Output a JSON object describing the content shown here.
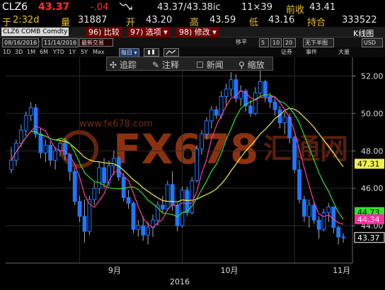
{
  "quote": {
    "ticker": "CLZ6",
    "last": "43.37",
    "change": "-.04",
    "bidask": "43.37/43.38ic",
    "size": "11×39",
    "prev_close_label": "前收",
    "prev_close": "43.41",
    "time_label": "于",
    "time": "2:32d",
    "volume_label": "量",
    "volume": "31887",
    "open_label": "开",
    "open": "43.20",
    "high_label": "高",
    "high": "43.59",
    "low_label": "低",
    "low": "43.16",
    "oi_label": "持合",
    "oi": "333522"
  },
  "ctrl": {
    "security": "CLZ6 COMB Comdty",
    "btn_compare": "96) 比较",
    "btn_options": "97) 选项 ▾",
    "btn_edit": "98) 修改 ▾",
    "chart_kind": "K线图",
    "date_from": "08/16/2016",
    "date_to": "11/14/2016",
    "period": "最新交易",
    "ma_label": "移平",
    "ma1": "5",
    "ma2": "10",
    "ma3": "20",
    "sub": "无下半图",
    "currency": "USD"
  },
  "ranges": [
    "1D",
    "3D",
    "1M",
    "6M",
    "YTD",
    "1Y",
    "5Y",
    "Max"
  ],
  "freq": "每日 ▾",
  "right_tools": [
    "证券",
    "事件",
    "大量"
  ],
  "toolbar": {
    "trace": "追踪",
    "annotate": "注释",
    "news": "新闻",
    "zoom": "缩放"
  },
  "watermark": "FX678",
  "watermark_cn": "汇通网",
  "watermark_url": "www.fx678.com",
  "colors": {
    "up": "#1e78ff",
    "down": "#1e78ff",
    "ma5": "#ff3ca0",
    "ma10": "#33e033",
    "ma20": "#f0f050",
    "label_yellow": "#f0f050",
    "label_magenta": "#ff2d9c",
    "label_green": "#2ee02e"
  },
  "labels": {
    "ma20": "47.31",
    "ma10": "44.73",
    "ma5": "44.34",
    "last": "43.37"
  },
  "chart_data": {
    "type": "candlestick",
    "x_labels": [
      "9月",
      "10月",
      "11月"
    ],
    "year_label": "2016",
    "y_ticks": [
      "52.00",
      "50.00",
      "48.00",
      "46.00",
      "44.00"
    ],
    "ylim": [
      42.0,
      53.0
    ],
    "candles": [
      [
        47.0,
        48.2,
        46.8,
        47.5
      ],
      [
        47.5,
        48.6,
        47.2,
        48.4
      ],
      [
        48.4,
        49.4,
        48.2,
        49.1
      ],
      [
        49.1,
        50.1,
        48.8,
        49.9
      ],
      [
        49.9,
        50.6,
        49.6,
        50.3
      ],
      [
        50.3,
        50.5,
        48.7,
        48.9
      ],
      [
        48.9,
        49.2,
        47.6,
        47.9
      ],
      [
        47.9,
        48.6,
        47.4,
        48.3
      ],
      [
        48.3,
        48.5,
        47.2,
        47.5
      ],
      [
        47.5,
        48.2,
        47.0,
        48.0
      ],
      [
        48.0,
        48.6,
        47.7,
        48.4
      ],
      [
        48.4,
        48.7,
        47.5,
        47.8
      ],
      [
        47.8,
        47.9,
        46.4,
        46.9
      ],
      [
        46.9,
        47.1,
        45.1,
        45.3
      ],
      [
        45.3,
        45.6,
        44.2,
        44.5
      ],
      [
        44.5,
        45.4,
        43.1,
        43.7
      ],
      [
        43.7,
        45.6,
        43.5,
        45.4
      ],
      [
        45.4,
        46.3,
        45.1,
        46.0
      ],
      [
        46.0,
        47.4,
        45.7,
        47.1
      ],
      [
        47.1,
        47.6,
        46.0,
        46.3
      ],
      [
        46.3,
        47.5,
        46.1,
        47.2
      ],
      [
        47.2,
        48.0,
        46.7,
        47.6
      ],
      [
        47.6,
        47.7,
        46.4,
        46.6
      ],
      [
        46.6,
        46.8,
        45.3,
        45.5
      ],
      [
        45.5,
        45.9,
        44.9,
        45.2
      ],
      [
        45.2,
        45.3,
        43.6,
        43.8
      ],
      [
        43.8,
        44.3,
        43.4,
        44.0
      ],
      [
        44.0,
        44.5,
        43.2,
        43.5
      ],
      [
        43.5,
        44.2,
        43.0,
        43.9
      ],
      [
        43.9,
        44.6,
        43.4,
        44.3
      ],
      [
        44.3,
        45.3,
        44.0,
        45.1
      ],
      [
        45.1,
        45.6,
        44.7,
        44.9
      ],
      [
        44.9,
        46.4,
        44.8,
        46.2
      ],
      [
        46.2,
        46.9,
        44.8,
        45.1
      ],
      [
        45.1,
        45.2,
        43.7,
        44.0
      ],
      [
        44.0,
        46.1,
        43.9,
        45.9
      ],
      [
        45.9,
        46.1,
        44.5,
        44.7
      ],
      [
        44.7,
        46.6,
        44.6,
        46.4
      ],
      [
        46.4,
        48.3,
        46.3,
        48.1
      ],
      [
        48.1,
        49.1,
        47.8,
        48.9
      ],
      [
        48.9,
        49.8,
        48.6,
        49.6
      ],
      [
        49.6,
        50.4,
        49.2,
        50.2
      ],
      [
        50.2,
        50.4,
        49.7,
        49.9
      ],
      [
        49.9,
        51.2,
        49.7,
        50.9
      ],
      [
        50.9,
        51.6,
        50.4,
        51.3
      ],
      [
        51.3,
        52.2,
        50.9,
        51.8
      ],
      [
        51.8,
        52.1,
        50.6,
        50.8
      ],
      [
        50.8,
        51.5,
        50.4,
        51.2
      ],
      [
        51.2,
        51.3,
        50.1,
        50.4
      ],
      [
        50.4,
        50.7,
        49.8,
        50.0
      ],
      [
        50.0,
        51.4,
        49.9,
        51.1
      ],
      [
        51.1,
        52.4,
        50.9,
        51.7
      ],
      [
        51.7,
        51.8,
        50.6,
        50.9
      ],
      [
        50.9,
        51.1,
        50.3,
        50.6
      ],
      [
        50.6,
        50.9,
        49.9,
        50.2
      ],
      [
        50.2,
        50.4,
        49.2,
        49.5
      ],
      [
        49.5,
        50.1,
        48.9,
        49.8
      ],
      [
        49.8,
        50.0,
        48.4,
        48.7
      ],
      [
        48.7,
        48.8,
        46.8,
        47.0
      ],
      [
        47.0,
        47.5,
        45.2,
        45.4
      ],
      [
        45.4,
        45.6,
        44.2,
        44.5
      ],
      [
        44.5,
        45.4,
        43.9,
        45.1
      ],
      [
        45.1,
        45.3,
        44.1,
        44.3
      ],
      [
        44.3,
        44.5,
        43.3,
        43.8
      ],
      [
        43.8,
        44.9,
        43.7,
        44.7
      ],
      [
        44.7,
        45.2,
        44.2,
        45.0
      ],
      [
        45.0,
        45.0,
        43.6,
        43.9
      ],
      [
        43.9,
        44.0,
        43.0,
        43.4
      ],
      [
        43.4,
        43.6,
        43.1,
        43.37
      ]
    ]
  }
}
